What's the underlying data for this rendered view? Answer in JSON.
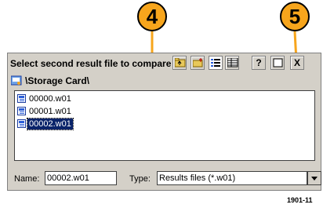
{
  "dialog": {
    "title": "Select second result file to compare",
    "toolbar": {
      "up_icon": "folder-up-icon",
      "new_folder_icon": "new-folder-icon",
      "list_view_icon": "list-view-icon",
      "details_view_icon": "details-view-icon",
      "help_label": "?",
      "ok_icon": "ok-icon",
      "close_label": "X"
    },
    "path": "\\Storage Card\\",
    "files": [
      {
        "name": "00000.w01",
        "selected": false
      },
      {
        "name": "00001.w01",
        "selected": false
      },
      {
        "name": "00002.w01",
        "selected": true
      }
    ],
    "name_label": "Name:",
    "name_value": "00002.w01",
    "type_label": "Type:",
    "type_value": "Results files (*.w01)"
  },
  "callouts": [
    "4",
    "5"
  ],
  "figure_number": "1901-11",
  "colors": {
    "callout": "#f7a51c",
    "selection": "#0a246a",
    "dialog_bg": "#d4d0c8"
  }
}
